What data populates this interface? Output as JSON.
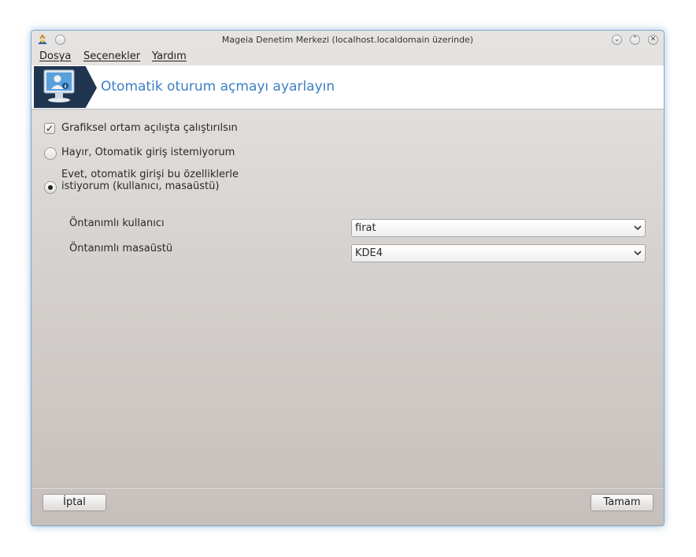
{
  "window": {
    "title": "Mageia Denetim Merkezi  (localhost.localdomain üzerinde)",
    "buttons": {
      "minimize": "⌄",
      "maximize": "⌃",
      "close": "✕"
    }
  },
  "menubar": [
    "Dosya",
    "Seçenekler",
    "Yardım"
  ],
  "banner": {
    "title": "Otomatik oturum açmayı ayarlayın",
    "icon": "user-monitor-icon"
  },
  "options": {
    "start_graphical": {
      "label": "Grafiksel ortam açılışta çalıştırılsın",
      "checked": true
    },
    "no_autologin": {
      "label": "Hayır, Otomatik giriş istemiyorum",
      "selected": false
    },
    "yes_autologin": {
      "label": "Evet, otomatik girişi bu özelliklerle istiyorum (kullanıcı, masaüstü)",
      "selected": true
    }
  },
  "fields": {
    "default_user": {
      "label": "Öntanımlı kullanıcı",
      "value": "firat"
    },
    "default_desktop": {
      "label": "Öntanımlı masaüstü",
      "value": "KDE4"
    }
  },
  "footer": {
    "cancel": "İptal",
    "ok": "Tamam"
  },
  "colors": {
    "accent": "#3b7fc4",
    "banner_icon_bg": "#1f3550",
    "window_border": "#7fa8c8"
  }
}
